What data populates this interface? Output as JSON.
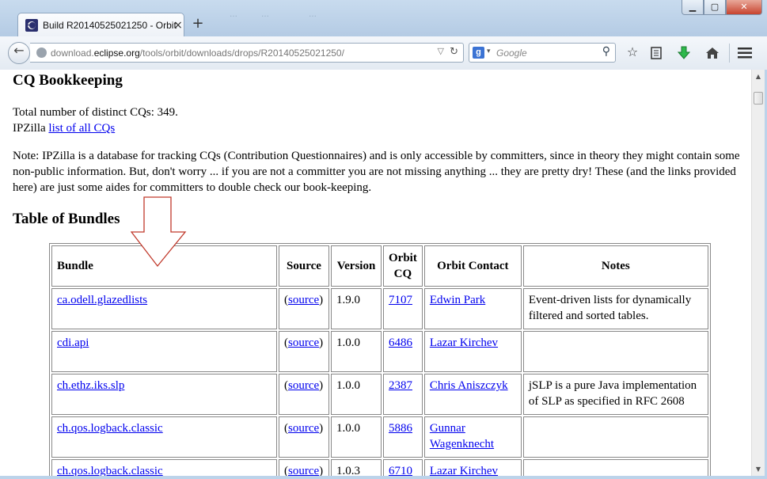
{
  "browser": {
    "tab_title": "Build R20140525021250 - Orbit...",
    "tab_close": "×",
    "new_tab": "+",
    "ghost_tabs": [
      "...",
      "...",
      "..."
    ],
    "url_prefix": "download.",
    "url_domain": "eclipse.org",
    "url_path": "/tools/orbit/downloads/drops/R20140525021250/",
    "search_placeholder": "Google",
    "search_engine_letter": "g",
    "window_min": "▁",
    "window_max": "▢",
    "window_close": "✕"
  },
  "page": {
    "cq_heading": "CQ Bookkeeping",
    "total_label": "Total number of distinct CQs: 349.",
    "ipzilla_prefix": "IPZilla ",
    "ipzilla_link": "list of all CQs",
    "note": "Note: IPZilla is a database for tracking CQs (Contribution Questionnaires) and is only accessible by committers, since in theory they might contain some non-public information. But, don't worry ... if you are not a committer you are not missing anything ... they are pretty dry! These (and the links provided here) are just some aides for committers to double check our book-keeping.",
    "bundles_heading": "Table of Bundles"
  },
  "table": {
    "headers": {
      "bundle": "Bundle",
      "source": "Source",
      "version": "Version",
      "orbit_cq_1": "Orbit",
      "orbit_cq_2": "CQ",
      "contact": "Orbit Contact",
      "notes": "Notes"
    },
    "paren_open": "(",
    "paren_close": ")",
    "rows": [
      {
        "bundle": "ca.odell.glazedlists",
        "source": "source",
        "version": "1.9.0",
        "cq": "7107",
        "contact": "Edwin Park",
        "notes": "Event-driven lists for dynamically filtered and sorted tables."
      },
      {
        "bundle": "cdi.api",
        "source": "source",
        "version": "1.0.0",
        "cq": "6486",
        "contact": "Lazar Kirchev",
        "notes": ""
      },
      {
        "bundle": "ch.ethz.iks.slp",
        "source": "source",
        "version": "1.0.0",
        "cq": "2387",
        "contact": "Chris Aniszczyk",
        "notes": "jSLP is a pure Java implementation of SLP as specified in RFC 2608"
      },
      {
        "bundle": "ch.qos.logback.classic",
        "source": "source",
        "version": "1.0.0",
        "cq": "5886",
        "contact": "Gunnar Wagenknecht",
        "notes": ""
      },
      {
        "bundle": "ch.qos.logback.classic",
        "source": "source",
        "version": "1.0.3",
        "cq": "6710",
        "contact": "Lazar Kirchev",
        "notes": ""
      }
    ]
  }
}
